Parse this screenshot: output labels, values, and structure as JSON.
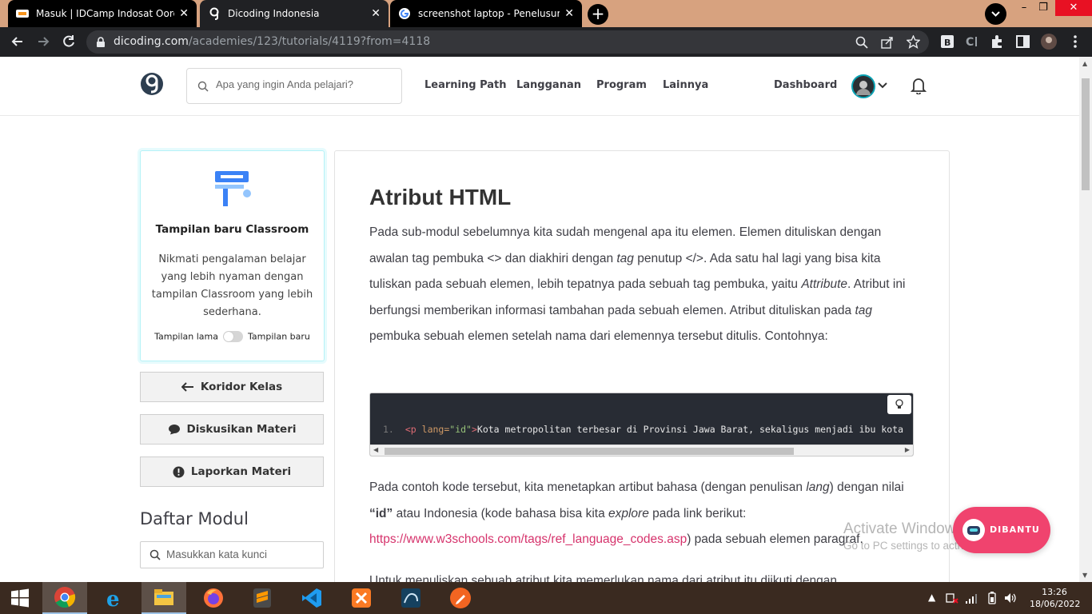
{
  "browser": {
    "tabs": [
      {
        "title": "Masuk | IDCamp Indosat Ooredoo",
        "favicon": "idcamp-icon"
      },
      {
        "title": "Dicoding Indonesia",
        "favicon": "dicoding-icon"
      },
      {
        "title": "screenshot laptop - Penelusuran G",
        "favicon": "google-icon"
      }
    ],
    "new_tab_label": "+",
    "close_label": "✕",
    "url_host": "dicoding.com",
    "url_path": "/academies/123/tutorials/4119?from=4118"
  },
  "header": {
    "search_placeholder": "Apa yang ingin Anda pelajari?",
    "nav": [
      "Learning Path",
      "Langganan",
      "Program",
      "Lainnya"
    ],
    "dashboard": "Dashboard"
  },
  "sidebar": {
    "card_title": "Tampilan baru Classroom",
    "card_desc": "Nikmati pengalaman belajar yang lebih nyaman dengan tampilan Classroom yang lebih sederhana.",
    "toggle_old": "Tampilan lama",
    "toggle_new": "Tampilan baru",
    "toggle_on": false,
    "buttons": {
      "koridor": "Koridor Kelas",
      "diskusi": "Diskusikan Materi",
      "lapor": "Laporkan Materi"
    },
    "module_title": "Daftar Modul",
    "module_search_placeholder": "Masukkan kata kunci"
  },
  "article": {
    "title": "Atribut HTML",
    "p1": {
      "a": "Pada sub-modul sebelumnya kita sudah mengenal apa itu elemen. Elemen dituliskan dengan awalan tag pembuka <> dan diakhiri dengan ",
      "em1": "tag",
      "b": " penutup </>. Ada satu hal lagi yang bisa kita tuliskan pada sebuah elemen, lebih tepatnya pada sebuah tag pembuka, yaitu ",
      "em2": "Attribute",
      "c": ". Atribut ini berfungsi memberikan informasi tambahan pada sebuah elemen. Atribut dituliskan pada ",
      "em3": "tag",
      "d": " pembuka sebuah elemen setelah nama dari elemennya tersebut ditulis. Contohnya:"
    },
    "code": {
      "line_no": "1.",
      "tag_open": "<p",
      "attr": " lang=",
      "value": "\"id\"",
      "tag_close": ">",
      "text": "Kota metropolitan terbesar di Provinsi Jawa Barat, sekaligus menjadi ibu kota"
    },
    "p2": {
      "a": "Pada contoh kode tersebut, kita menetapkan artibut bahasa (dengan penulisan ",
      "em1": "lang",
      "b": ") dengan nilai ",
      "strong": "“id”",
      "c": " atau Indonesia (kode bahasa bisa kita ",
      "em2": "explore",
      "d": " pada link berikut: ",
      "link": "https://www.w3schools.com/tags/ref_language_codes.asp",
      "e": ") pada sebuah elemen paragraf."
    },
    "p3_partial": "Untuk menuliskan sebuah atribut kita memerlukan nama dari atribut itu diikuti dengan"
  },
  "chat_widget": {
    "label": "DIBANTU"
  },
  "watermark": {
    "line1": "Activate Windows",
    "line2": "Go to PC settings to activate Windows."
  },
  "taskbar": {
    "apps": [
      "start-icon",
      "chrome-icon",
      "ie-icon",
      "file-explorer-icon",
      "firefox-icon",
      "sublime-icon",
      "vscode-icon",
      "xampp-icon",
      "mysql-workbench-icon",
      "pen-app-icon"
    ],
    "time": "13:26",
    "date": "18/06/2022"
  },
  "colors": {
    "tabstrip": "#d7a27f",
    "chrome_dark": "#202124",
    "accent_link": "#d6336c",
    "chat_widget": "#f0436e",
    "card_border": "#b5f2f7"
  }
}
